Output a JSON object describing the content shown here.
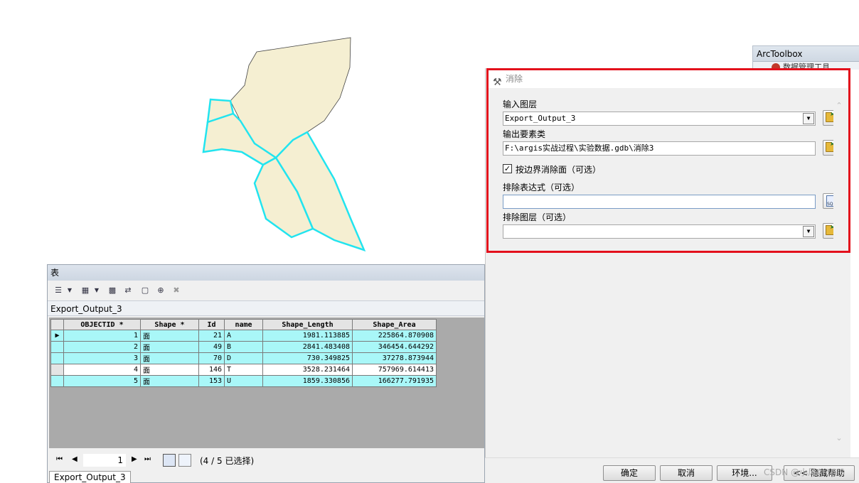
{
  "arctoolbox": {
    "title": "ArcToolbox",
    "item_label": "数据管理工具"
  },
  "tool_dialog": {
    "title": "消除",
    "params": {
      "input_layer_label": "输入图层",
      "input_layer_value": "Export_Output_3",
      "output_features_label": "输出要素类",
      "output_features_value": "F:\\argis实战过程\\实验数据.gdb\\消除3",
      "checkbox_label": "按边界消除面（可选）",
      "checkbox_checked": true,
      "exclusion_expr_label": "排除表达式（可选）",
      "exclusion_expr_value": "",
      "exclusion_layer_label": "排除图层（可选）",
      "exclusion_layer_value": ""
    },
    "buttons": {
      "ok": "确定",
      "cancel": "取消",
      "env": "环境...",
      "hide_help": "<< 隐藏帮助"
    }
  },
  "table_window": {
    "title": "表",
    "table_name": "Export_Output_3",
    "columns": [
      "OBJECTID *",
      "Shape *",
      "Id",
      "name",
      "Shape_Length",
      "Shape_Area"
    ],
    "rows": [
      {
        "OBJECTID": "1",
        "Shape": "面",
        "Id": "21",
        "name": "A",
        "Shape_Length": "1981.113885",
        "Shape_Area": "225864.870908",
        "selected": true
      },
      {
        "OBJECTID": "2",
        "Shape": "面",
        "Id": "49",
        "name": "B",
        "Shape_Length": "2841.483408",
        "Shape_Area": "346454.644292",
        "selected": true
      },
      {
        "OBJECTID": "3",
        "Shape": "面",
        "Id": "70",
        "name": "D",
        "Shape_Length": "730.349825",
        "Shape_Area": "37278.873944",
        "selected": true
      },
      {
        "OBJECTID": "4",
        "Shape": "面",
        "Id": "146",
        "name": "T",
        "Shape_Length": "3528.231464",
        "Shape_Area": "757969.614413",
        "selected": false
      },
      {
        "OBJECTID": "5",
        "Shape": "面",
        "Id": "153",
        "name": "U",
        "Shape_Length": "1859.330856",
        "Shape_Area": "166277.791935",
        "selected": true
      }
    ],
    "current_record": "1",
    "status": "(4 / 5 已选择)",
    "bottom_tab": "Export_Output_3"
  },
  "map": {
    "polygon_fill": "#f5efd2",
    "selection_outline": "#22e4ef"
  },
  "watermark": "CSDN @小风ArcGIS"
}
